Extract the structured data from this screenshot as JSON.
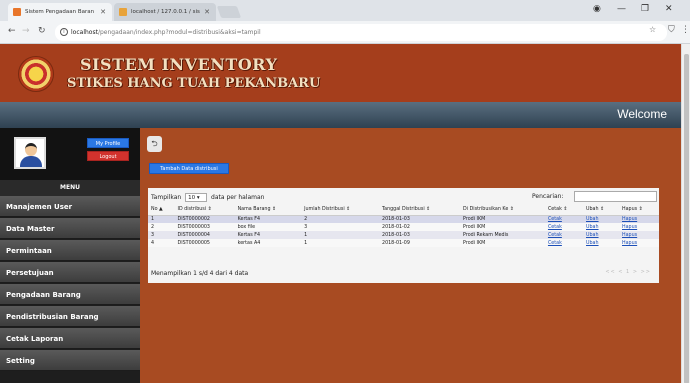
{
  "browser": {
    "tabs": [
      {
        "label": "Sistem Pengadaan Baran",
        "color": "#e8752a"
      },
      {
        "label": "localhost / 127.0.0.1 / sis",
        "color": "#e8a33a"
      }
    ],
    "url_host": "localhost",
    "url_path": "/pengadaan/index.php?modul=distribusi&aksi=tampil"
  },
  "header": {
    "title": "SISTEM INVENTORY",
    "subtitle": "STIKES HANG TUAH PEKANBARU",
    "welcome": "Welcome"
  },
  "sidebar": {
    "profile_label": "My Profile",
    "logout_label": "Logout",
    "menu_heading": "MENU",
    "items": [
      {
        "label": "Manajemen User"
      },
      {
        "label": "Data Master"
      },
      {
        "label": "Permintaan"
      },
      {
        "label": "Persetujuan"
      },
      {
        "label": "Pengadaan Barang"
      },
      {
        "label": "Pendistribusian Barang"
      },
      {
        "label": "Cetak Laporan"
      },
      {
        "label": "Setting"
      }
    ]
  },
  "main": {
    "add_button": "Tambah Data distribusi",
    "show_prefix": "Tampilkan",
    "show_value": "10",
    "show_suffix": "data per halaman",
    "search_label": "Pencarian:",
    "columns": [
      "No",
      "ID distribusi",
      "Nama Barang",
      "Jumlah Distribusi",
      "Tanggal Distribusi",
      "Di Distribusikan Ke",
      "Cetak",
      "Ubah",
      "Hapus"
    ],
    "rows": [
      {
        "no": "1",
        "id": "DIST0000002",
        "nama": "Kertas F4",
        "jumlah": "2",
        "tanggal": "2018-01-03",
        "tujuan": "Prodi IKM",
        "cetak": "Cetak",
        "ubah": "Ubah",
        "hapus": "Hapus"
      },
      {
        "no": "2",
        "id": "DIST0000003",
        "nama": "box file",
        "jumlah": "3",
        "tanggal": "2018-01-02",
        "tujuan": "Prodi IKM",
        "cetak": "Cetak",
        "ubah": "Ubah",
        "hapus": "Hapus"
      },
      {
        "no": "3",
        "id": "DIST0000004",
        "nama": "Kertas F4",
        "jumlah": "1",
        "tanggal": "2018-01-03",
        "tujuan": "Prodi Rekam Medis",
        "cetak": "Cetak",
        "ubah": "Ubah",
        "hapus": "Hapus"
      },
      {
        "no": "4",
        "id": "DIST0000005",
        "nama": "kertas A4",
        "jumlah": "1",
        "tanggal": "2018-01-09",
        "tujuan": "Prodi IKM",
        "cetak": "Cetak",
        "ubah": "Ubah",
        "hapus": "Hapus"
      }
    ],
    "info": "Menampilkan 1 s/d 4 dari 4 data",
    "pager": "<< < 1 > >>"
  }
}
